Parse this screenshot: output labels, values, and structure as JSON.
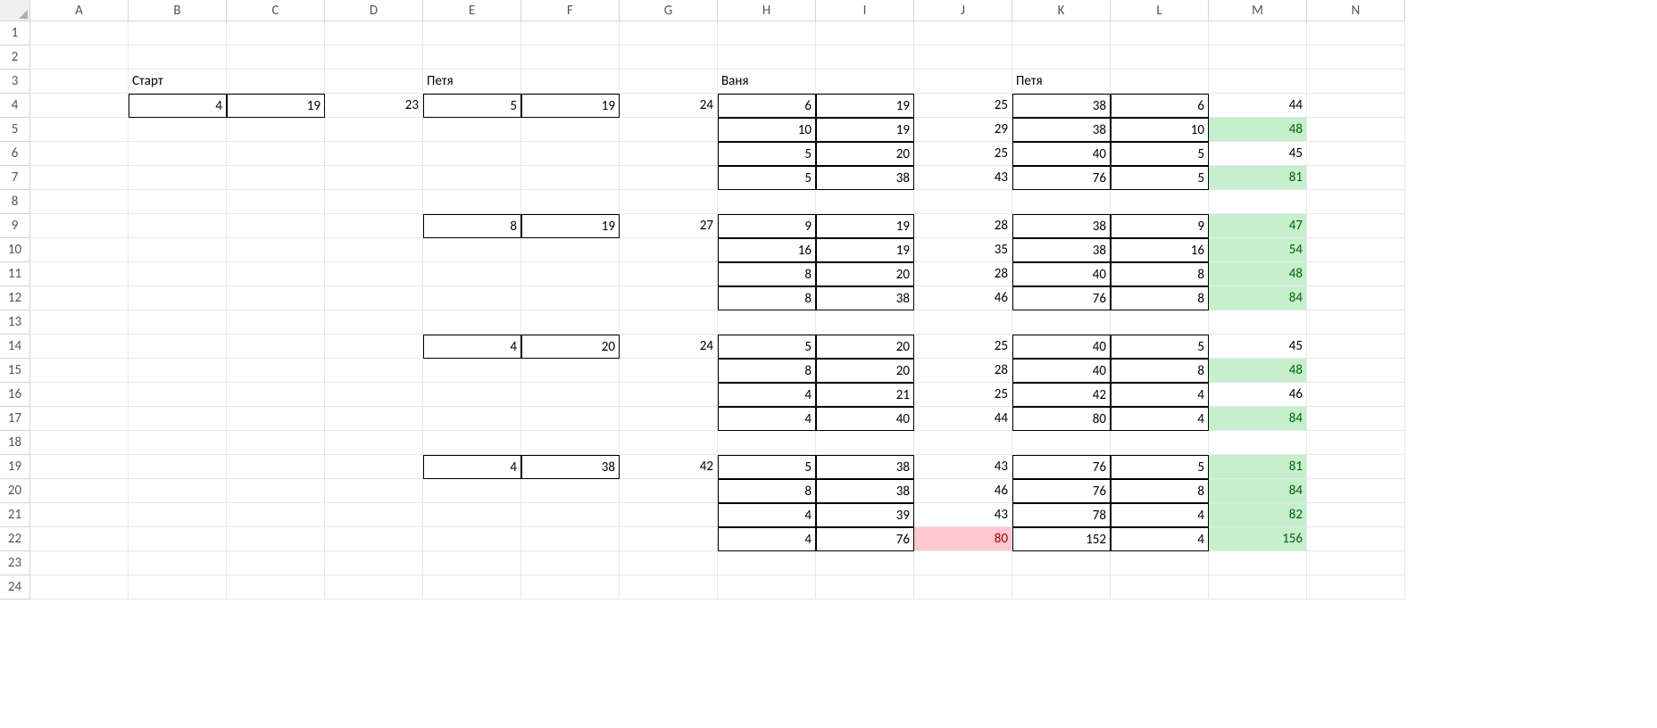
{
  "columns": [
    "A",
    "B",
    "C",
    "D",
    "E",
    "F",
    "G",
    "H",
    "I",
    "J",
    "K",
    "L",
    "M",
    "N"
  ],
  "rowCount": 24,
  "labels": {
    "start": "Старт",
    "petya": "Петя",
    "vanya": "Ваня"
  },
  "cells": [
    {
      "r": 3,
      "c": "B",
      "v": "Старт",
      "align": "txt"
    },
    {
      "r": 3,
      "c": "E",
      "v": "Петя",
      "align": "txt"
    },
    {
      "r": 3,
      "c": "H",
      "v": "Ваня",
      "align": "txt"
    },
    {
      "r": 3,
      "c": "K",
      "v": "Петя",
      "align": "txt"
    },
    {
      "r": 4,
      "c": "B",
      "v": "4",
      "align": "num",
      "border": true
    },
    {
      "r": 4,
      "c": "C",
      "v": "19",
      "align": "num",
      "border": true
    },
    {
      "r": 4,
      "c": "D",
      "v": "23",
      "align": "num"
    },
    {
      "r": 4,
      "c": "E",
      "v": "5",
      "align": "num",
      "border": true
    },
    {
      "r": 4,
      "c": "F",
      "v": "19",
      "align": "num",
      "border": true
    },
    {
      "r": 4,
      "c": "G",
      "v": "24",
      "align": "num"
    },
    {
      "r": 4,
      "c": "H",
      "v": "6",
      "align": "num",
      "border": true
    },
    {
      "r": 4,
      "c": "I",
      "v": "19",
      "align": "num",
      "border": true
    },
    {
      "r": 4,
      "c": "J",
      "v": "25",
      "align": "num"
    },
    {
      "r": 4,
      "c": "K",
      "v": "38",
      "align": "num",
      "border": true
    },
    {
      "r": 4,
      "c": "L",
      "v": "6",
      "align": "num",
      "border": true
    },
    {
      "r": 4,
      "c": "M",
      "v": "44",
      "align": "num"
    },
    {
      "r": 5,
      "c": "H",
      "v": "10",
      "align": "num",
      "border": true
    },
    {
      "r": 5,
      "c": "I",
      "v": "19",
      "align": "num",
      "border": true
    },
    {
      "r": 5,
      "c": "J",
      "v": "29",
      "align": "num"
    },
    {
      "r": 5,
      "c": "K",
      "v": "38",
      "align": "num",
      "border": true
    },
    {
      "r": 5,
      "c": "L",
      "v": "10",
      "align": "num",
      "border": true
    },
    {
      "r": 5,
      "c": "M",
      "v": "48",
      "align": "num",
      "fill": "green"
    },
    {
      "r": 6,
      "c": "H",
      "v": "5",
      "align": "num",
      "border": true
    },
    {
      "r": 6,
      "c": "I",
      "v": "20",
      "align": "num",
      "border": true
    },
    {
      "r": 6,
      "c": "J",
      "v": "25",
      "align": "num"
    },
    {
      "r": 6,
      "c": "K",
      "v": "40",
      "align": "num",
      "border": true
    },
    {
      "r": 6,
      "c": "L",
      "v": "5",
      "align": "num",
      "border": true
    },
    {
      "r": 6,
      "c": "M",
      "v": "45",
      "align": "num"
    },
    {
      "r": 7,
      "c": "H",
      "v": "5",
      "align": "num",
      "border": true
    },
    {
      "r": 7,
      "c": "I",
      "v": "38",
      "align": "num",
      "border": true
    },
    {
      "r": 7,
      "c": "J",
      "v": "43",
      "align": "num"
    },
    {
      "r": 7,
      "c": "K",
      "v": "76",
      "align": "num",
      "border": true
    },
    {
      "r": 7,
      "c": "L",
      "v": "5",
      "align": "num",
      "border": true
    },
    {
      "r": 7,
      "c": "M",
      "v": "81",
      "align": "num",
      "fill": "green"
    },
    {
      "r": 9,
      "c": "E",
      "v": "8",
      "align": "num",
      "border": true
    },
    {
      "r": 9,
      "c": "F",
      "v": "19",
      "align": "num",
      "border": true
    },
    {
      "r": 9,
      "c": "G",
      "v": "27",
      "align": "num"
    },
    {
      "r": 9,
      "c": "H",
      "v": "9",
      "align": "num",
      "border": true
    },
    {
      "r": 9,
      "c": "I",
      "v": "19",
      "align": "num",
      "border": true
    },
    {
      "r": 9,
      "c": "J",
      "v": "28",
      "align": "num"
    },
    {
      "r": 9,
      "c": "K",
      "v": "38",
      "align": "num",
      "border": true
    },
    {
      "r": 9,
      "c": "L",
      "v": "9",
      "align": "num",
      "border": true
    },
    {
      "r": 9,
      "c": "M",
      "v": "47",
      "align": "num",
      "fill": "green"
    },
    {
      "r": 10,
      "c": "H",
      "v": "16",
      "align": "num",
      "border": true
    },
    {
      "r": 10,
      "c": "I",
      "v": "19",
      "align": "num",
      "border": true
    },
    {
      "r": 10,
      "c": "J",
      "v": "35",
      "align": "num"
    },
    {
      "r": 10,
      "c": "K",
      "v": "38",
      "align": "num",
      "border": true
    },
    {
      "r": 10,
      "c": "L",
      "v": "16",
      "align": "num",
      "border": true
    },
    {
      "r": 10,
      "c": "M",
      "v": "54",
      "align": "num",
      "fill": "green"
    },
    {
      "r": 11,
      "c": "H",
      "v": "8",
      "align": "num",
      "border": true
    },
    {
      "r": 11,
      "c": "I",
      "v": "20",
      "align": "num",
      "border": true
    },
    {
      "r": 11,
      "c": "J",
      "v": "28",
      "align": "num"
    },
    {
      "r": 11,
      "c": "K",
      "v": "40",
      "align": "num",
      "border": true
    },
    {
      "r": 11,
      "c": "L",
      "v": "8",
      "align": "num",
      "border": true
    },
    {
      "r": 11,
      "c": "M",
      "v": "48",
      "align": "num",
      "fill": "green"
    },
    {
      "r": 12,
      "c": "H",
      "v": "8",
      "align": "num",
      "border": true
    },
    {
      "r": 12,
      "c": "I",
      "v": "38",
      "align": "num",
      "border": true
    },
    {
      "r": 12,
      "c": "J",
      "v": "46",
      "align": "num"
    },
    {
      "r": 12,
      "c": "K",
      "v": "76",
      "align": "num",
      "border": true
    },
    {
      "r": 12,
      "c": "L",
      "v": "8",
      "align": "num",
      "border": true
    },
    {
      "r": 12,
      "c": "M",
      "v": "84",
      "align": "num",
      "fill": "green"
    },
    {
      "r": 14,
      "c": "E",
      "v": "4",
      "align": "num",
      "border": true
    },
    {
      "r": 14,
      "c": "F",
      "v": "20",
      "align": "num",
      "border": true
    },
    {
      "r": 14,
      "c": "G",
      "v": "24",
      "align": "num"
    },
    {
      "r": 14,
      "c": "H",
      "v": "5",
      "align": "num",
      "border": true
    },
    {
      "r": 14,
      "c": "I",
      "v": "20",
      "align": "num",
      "border": true
    },
    {
      "r": 14,
      "c": "J",
      "v": "25",
      "align": "num"
    },
    {
      "r": 14,
      "c": "K",
      "v": "40",
      "align": "num",
      "border": true
    },
    {
      "r": 14,
      "c": "L",
      "v": "5",
      "align": "num",
      "border": true
    },
    {
      "r": 14,
      "c": "M",
      "v": "45",
      "align": "num"
    },
    {
      "r": 15,
      "c": "H",
      "v": "8",
      "align": "num",
      "border": true
    },
    {
      "r": 15,
      "c": "I",
      "v": "20",
      "align": "num",
      "border": true
    },
    {
      "r": 15,
      "c": "J",
      "v": "28",
      "align": "num"
    },
    {
      "r": 15,
      "c": "K",
      "v": "40",
      "align": "num",
      "border": true
    },
    {
      "r": 15,
      "c": "L",
      "v": "8",
      "align": "num",
      "border": true
    },
    {
      "r": 15,
      "c": "M",
      "v": "48",
      "align": "num",
      "fill": "green"
    },
    {
      "r": 16,
      "c": "H",
      "v": "4",
      "align": "num",
      "border": true
    },
    {
      "r": 16,
      "c": "I",
      "v": "21",
      "align": "num",
      "border": true
    },
    {
      "r": 16,
      "c": "J",
      "v": "25",
      "align": "num"
    },
    {
      "r": 16,
      "c": "K",
      "v": "42",
      "align": "num",
      "border": true
    },
    {
      "r": 16,
      "c": "L",
      "v": "4",
      "align": "num",
      "border": true
    },
    {
      "r": 16,
      "c": "M",
      "v": "46",
      "align": "num"
    },
    {
      "r": 17,
      "c": "H",
      "v": "4",
      "align": "num",
      "border": true
    },
    {
      "r": 17,
      "c": "I",
      "v": "40",
      "align": "num",
      "border": true
    },
    {
      "r": 17,
      "c": "J",
      "v": "44",
      "align": "num"
    },
    {
      "r": 17,
      "c": "K",
      "v": "80",
      "align": "num",
      "border": true
    },
    {
      "r": 17,
      "c": "L",
      "v": "4",
      "align": "num",
      "border": true
    },
    {
      "r": 17,
      "c": "M",
      "v": "84",
      "align": "num",
      "fill": "green"
    },
    {
      "r": 19,
      "c": "E",
      "v": "4",
      "align": "num",
      "border": true
    },
    {
      "r": 19,
      "c": "F",
      "v": "38",
      "align": "num",
      "border": true
    },
    {
      "r": 19,
      "c": "G",
      "v": "42",
      "align": "num"
    },
    {
      "r": 19,
      "c": "H",
      "v": "5",
      "align": "num",
      "border": true
    },
    {
      "r": 19,
      "c": "I",
      "v": "38",
      "align": "num",
      "border": true
    },
    {
      "r": 19,
      "c": "J",
      "v": "43",
      "align": "num"
    },
    {
      "r": 19,
      "c": "K",
      "v": "76",
      "align": "num",
      "border": true
    },
    {
      "r": 19,
      "c": "L",
      "v": "5",
      "align": "num",
      "border": true
    },
    {
      "r": 19,
      "c": "M",
      "v": "81",
      "align": "num",
      "fill": "green"
    },
    {
      "r": 20,
      "c": "H",
      "v": "8",
      "align": "num",
      "border": true
    },
    {
      "r": 20,
      "c": "I",
      "v": "38",
      "align": "num",
      "border": true
    },
    {
      "r": 20,
      "c": "J",
      "v": "46",
      "align": "num"
    },
    {
      "r": 20,
      "c": "K",
      "v": "76",
      "align": "num",
      "border": true
    },
    {
      "r": 20,
      "c": "L",
      "v": "8",
      "align": "num",
      "border": true
    },
    {
      "r": 20,
      "c": "M",
      "v": "84",
      "align": "num",
      "fill": "green"
    },
    {
      "r": 21,
      "c": "H",
      "v": "4",
      "align": "num",
      "border": true
    },
    {
      "r": 21,
      "c": "I",
      "v": "39",
      "align": "num",
      "border": true
    },
    {
      "r": 21,
      "c": "J",
      "v": "43",
      "align": "num"
    },
    {
      "r": 21,
      "c": "K",
      "v": "78",
      "align": "num",
      "border": true
    },
    {
      "r": 21,
      "c": "L",
      "v": "4",
      "align": "num",
      "border": true
    },
    {
      "r": 21,
      "c": "M",
      "v": "82",
      "align": "num",
      "fill": "green"
    },
    {
      "r": 22,
      "c": "H",
      "v": "4",
      "align": "num",
      "border": true
    },
    {
      "r": 22,
      "c": "I",
      "v": "76",
      "align": "num",
      "border": true
    },
    {
      "r": 22,
      "c": "J",
      "v": "80",
      "align": "num",
      "fill": "red"
    },
    {
      "r": 22,
      "c": "K",
      "v": "152",
      "align": "num",
      "border": true
    },
    {
      "r": 22,
      "c": "L",
      "v": "4",
      "align": "num",
      "border": true
    },
    {
      "r": 22,
      "c": "M",
      "v": "156",
      "align": "num",
      "fill": "green"
    }
  ]
}
